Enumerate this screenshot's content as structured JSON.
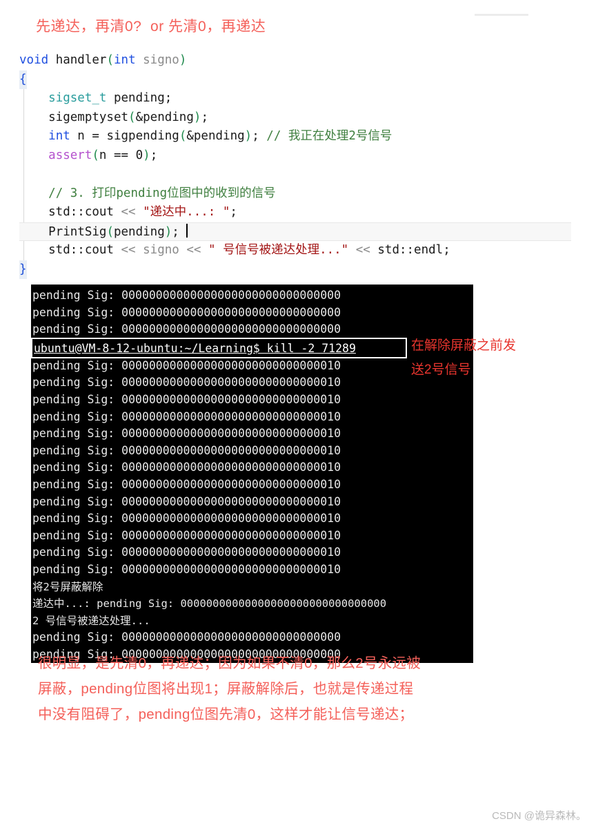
{
  "heading": "先递达，再清0?  or 先清0，再递达",
  "code": {
    "lines": [
      {
        "tokens": [
          {
            "t": "void",
            "c": "kw"
          },
          {
            "t": " handler",
            "c": "fn"
          },
          {
            "t": "(",
            "c": "paren"
          },
          {
            "t": "int",
            "c": "kw"
          },
          {
            "t": " signo",
            "c": "param"
          },
          {
            "t": ")",
            "c": "paren"
          }
        ]
      },
      {
        "tokens": [
          {
            "t": "{",
            "c": "brace"
          }
        ]
      },
      {
        "tokens": [
          {
            "t": "    ",
            "c": "fn"
          },
          {
            "t": "sigset_t",
            "c": "typ"
          },
          {
            "t": " pending;",
            "c": "fn"
          }
        ]
      },
      {
        "tokens": [
          {
            "t": "    sigemptyset",
            "c": "fn"
          },
          {
            "t": "(",
            "c": "paren"
          },
          {
            "t": "&pending",
            "c": "fn"
          },
          {
            "t": ")",
            "c": "paren"
          },
          {
            "t": ";",
            "c": "fn"
          }
        ]
      },
      {
        "tokens": [
          {
            "t": "    ",
            "c": "fn"
          },
          {
            "t": "int",
            "c": "kw"
          },
          {
            "t": " n = sigpending",
            "c": "fn"
          },
          {
            "t": "(",
            "c": "paren"
          },
          {
            "t": "&pending",
            "c": "fn"
          },
          {
            "t": ")",
            "c": "paren"
          },
          {
            "t": "; ",
            "c": "fn"
          },
          {
            "t": "// 我正在处理2号信号",
            "c": "cmt"
          }
        ]
      },
      {
        "tokens": [
          {
            "t": "    ",
            "c": "fn"
          },
          {
            "t": "assert",
            "c": "macro"
          },
          {
            "t": "(",
            "c": "paren"
          },
          {
            "t": "n == ",
            "c": "fn"
          },
          {
            "t": "0",
            "c": "num"
          },
          {
            "t": ")",
            "c": "paren"
          },
          {
            "t": ";",
            "c": "fn"
          }
        ]
      },
      {
        "tokens": [
          {
            "t": "",
            "c": "fn"
          }
        ]
      },
      {
        "tokens": [
          {
            "t": "    ",
            "c": "fn"
          },
          {
            "t": "// 3. 打印pending位图中的收到的信号",
            "c": "cmt"
          }
        ]
      },
      {
        "tokens": [
          {
            "t": "    std::cout ",
            "c": "fn"
          },
          {
            "t": "<<",
            "c": "op"
          },
          {
            "t": " ",
            "c": "fn"
          },
          {
            "t": "\"递达中...: \"",
            "c": "str"
          },
          {
            "t": ";",
            "c": "fn"
          }
        ]
      },
      {
        "current": true,
        "cursor": true,
        "tokens": [
          {
            "t": "    PrintSig",
            "c": "fn"
          },
          {
            "t": "(",
            "c": "paren"
          },
          {
            "t": "pending",
            "c": "fn"
          },
          {
            "t": ")",
            "c": "paren"
          },
          {
            "t": "; ",
            "c": "fn"
          }
        ]
      },
      {
        "tokens": [
          {
            "t": "    std::cout ",
            "c": "fn"
          },
          {
            "t": "<<",
            "c": "op"
          },
          {
            "t": " ",
            "c": "fn"
          },
          {
            "t": "signo",
            "c": "param"
          },
          {
            "t": " ",
            "c": "fn"
          },
          {
            "t": "<<",
            "c": "op"
          },
          {
            "t": " ",
            "c": "fn"
          },
          {
            "t": "\" 号信号被递达处理...\"",
            "c": "str"
          },
          {
            "t": " ",
            "c": "fn"
          },
          {
            "t": "<<",
            "c": "op"
          },
          {
            "t": " std::endl;",
            "c": "fn"
          }
        ]
      },
      {
        "tokens": [
          {
            "t": "}",
            "c": "brace"
          }
        ]
      }
    ]
  },
  "terminal": {
    "lines_before": [
      "pending Sig: 00000000000000000000000000000000",
      "pending Sig: 00000000000000000000000000000000",
      "pending Sig: 00000000000000000000000000000000"
    ],
    "command": "ubuntu@VM-8-12-ubuntu:~/Learning$ kill -2 71289",
    "lines_after": [
      "pending Sig: 00000000000000000000000000000010",
      "pending Sig: 00000000000000000000000000000010",
      "pending Sig: 00000000000000000000000000000010",
      "pending Sig: 00000000000000000000000000000010",
      "pending Sig: 00000000000000000000000000000010",
      "pending Sig: 00000000000000000000000000000010",
      "pending Sig: 00000000000000000000000000000010",
      "pending Sig: 00000000000000000000000000000010",
      "pending Sig: 00000000000000000000000000000010",
      "pending Sig: 00000000000000000000000000000010",
      "pending Sig: 00000000000000000000000000000010",
      "pending Sig: 00000000000000000000000000000010",
      "pending Sig: 00000000000000000000000000000010"
    ],
    "lines_tail": [
      {
        "text": "将2号屏蔽解除",
        "cn": true
      },
      {
        "text": "递达中...: pending Sig: 00000000000000000000000000000000",
        "cn": true
      },
      {
        "text": "2 号信号被递达处理...",
        "cn": true
      },
      {
        "text": "pending Sig: 00000000000000000000000000000000",
        "cn": false
      },
      {
        "text": "pending Sig: 00000000000000000000000000000000",
        "cn": false
      }
    ]
  },
  "side_note": "在解除屏蔽之前发\n送2号信号",
  "bottom_note": "很明显，是先清0，再递达；因为如果不清0，那么2号永远被\n屏蔽，pending位图将出现1；屏蔽解除后，也就是传递过程\n中没有阻碍了，pending位图先清0，这样才能让信号递达；",
  "watermark": "CSDN @诡异森林。",
  "colors": {
    "annotation_red": "#f4605a",
    "side_note_red": "#e8352e",
    "terminal_bg": "#000000",
    "terminal_fg": "#e8e8e8"
  }
}
